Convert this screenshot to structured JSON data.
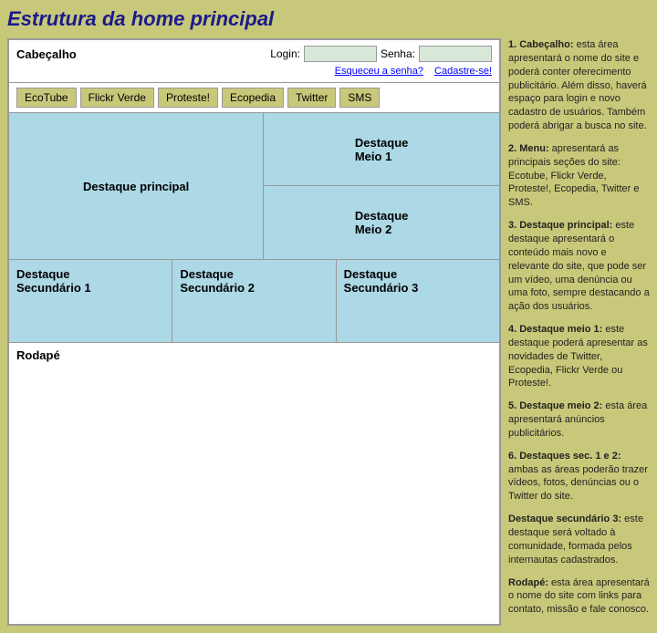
{
  "page": {
    "title": "Estrutura da home principal"
  },
  "header": {
    "label": "Cabeçalho",
    "login_label": "Login:",
    "senha_label": "Senha:",
    "forgot_link": "Esqueceu a senha?",
    "register_link": "Cadastre-se!"
  },
  "nav": {
    "items": [
      {
        "label": "EcoTube"
      },
      {
        "label": "Flickr Verde"
      },
      {
        "label": "Proteste!"
      },
      {
        "label": "Ecopedia"
      },
      {
        "label": "Twitter"
      },
      {
        "label": "SMS"
      }
    ]
  },
  "content": {
    "main_highlight": "Destaque principal",
    "meio1": "Destaque\nMeio 1",
    "meio2": "Destaque\nMeio 2",
    "sec1": "Destaque\nSecundário 1",
    "sec2": "Destaque\nSecundário 2",
    "sec3": "Destaque\nSecundário 3"
  },
  "footer": {
    "label": "Rodapé"
  },
  "sidebar": {
    "item1_title": "1. Cabeçalho:",
    "item1_text": " esta área apresentará o nome do site e poderá conter oferecimento publicitário. Além disso, haverá espaço para login e novo cadastro de usuários. Também poderá abrigar a busca no site.",
    "item2_title": "2. Menu:",
    "item2_text": " apresentará as principais seções do site: Ecotube, Flickr Verde, Proteste!, Ecopedia, Twitter e SMS.",
    "item3_title": "3. Destaque principal:",
    "item3_text": " este destaque apresentará o conteúdo mais novo e relevante do site, que pode ser um vídeo, uma denúncia ou uma foto, sempre destacando a ação dos usuários.",
    "item4_title": "4. Destaque meio 1:",
    "item4_text": " este destaque poderá apresentar as novidades de Twitter, Ecopedia, Flickr Verde ou Proteste!.",
    "item5_title": "5. Destaque meio 2:",
    "item5_text": " esta área apresentará anúncios publicitários.",
    "item6_title": "6. Destaques sec. 1 e 2:",
    "item6_text": " ambas as áreas poderão trazer vídeos, fotos, denúncias ou o Twitter do site.",
    "item7_title": "Destaque secundário 3:",
    "item7_text": " este destaque será voltado à comunidade, formada pelos internautas cadastrados.",
    "item8_title": "Rodapé:",
    "item8_text": " esta área apresentará o nome do site com links para contato, missão e fale conosco."
  }
}
